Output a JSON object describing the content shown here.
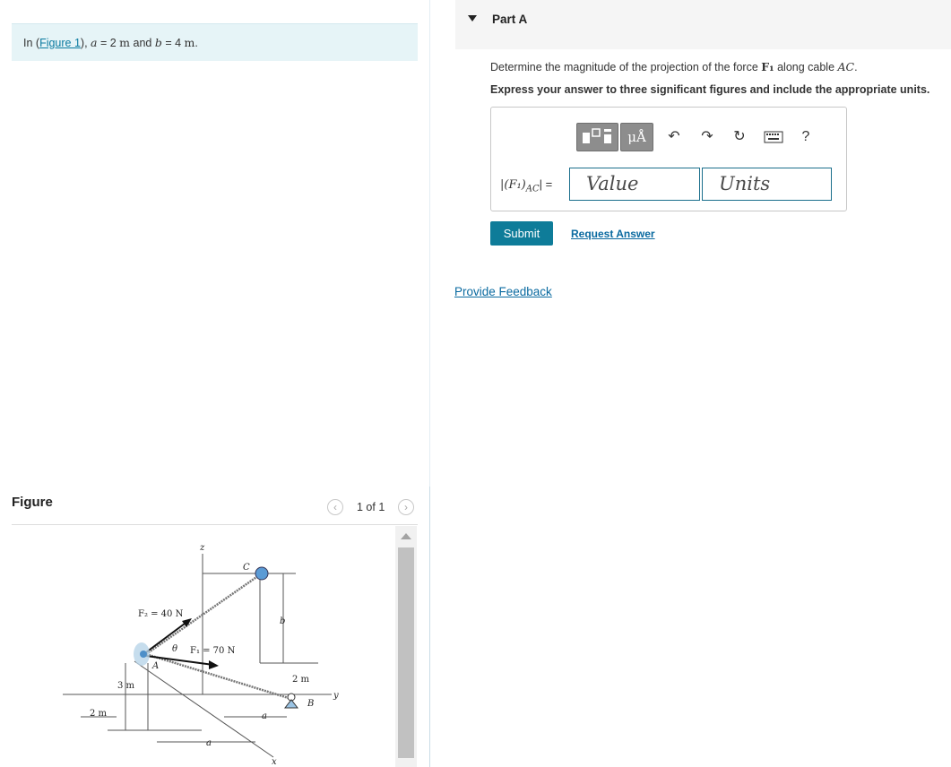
{
  "intro": {
    "prefix": "In (",
    "figure_link": "Figure 1",
    "suffix": "),",
    "a_var": "a",
    "a_eq": " = 2 ",
    "a_unit": "m",
    "and": " and ",
    "b_var": "b",
    "b_eq": " = 4 ",
    "b_unit": "m",
    "period": "."
  },
  "figure_panel": {
    "title": "Figure",
    "pager": "1 of 1",
    "prev_icon": "chevron-left-icon",
    "next_icon": "chevron-right-icon",
    "labels": {
      "z": "z",
      "c": "C",
      "f2": "F₂ = 40 N",
      "b": "b",
      "theta": "θ",
      "f1": "F₁ = 70 N",
      "a_point": "A",
      "three_m": "3 m",
      "two_m_left": "2 m",
      "two_m_right": "2 m",
      "y": "y",
      "b_point": "B",
      "a_dim_right": "a",
      "a_dim_bottom": "a",
      "x": "x"
    }
  },
  "part": {
    "title": "Part A",
    "caret_icon": "caret-down-icon",
    "question_pre": "Determine the magnitude of the projection of the force ",
    "question_force": "F₁",
    "question_mid": " along cable ",
    "question_cable": "AC",
    "question_end": ".",
    "instruction": "Express your answer to three significant figures and include the appropriate units.",
    "toolbar": {
      "units_label": "μÅ",
      "help_label": "?",
      "icons": [
        "templates-icon",
        "units-icon",
        "undo-icon",
        "redo-icon",
        "reset-icon",
        "keyboard-icon",
        "help-icon"
      ]
    },
    "answer_label": "|(F₁)",
    "answer_sub": "AC",
    "answer_suffix": "| =",
    "value_placeholder": "Value",
    "units_placeholder": "Units",
    "submit_label": "Submit",
    "request_answer_label": "Request Answer"
  },
  "feedback_label": "Provide Feedback",
  "colors": {
    "accent": "#0e7c99",
    "link": "#0a6aa0",
    "intro_bg": "#e6f4f7",
    "toolbar_button": "#8d8d8d"
  }
}
